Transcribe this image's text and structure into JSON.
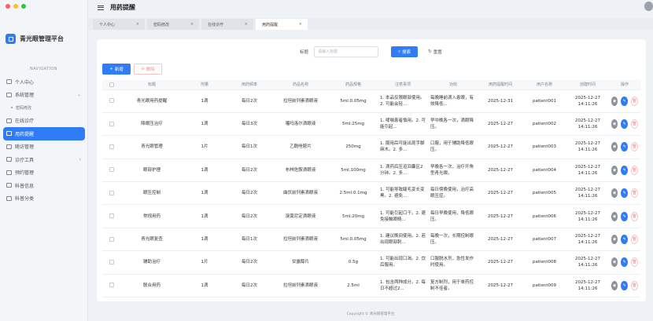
{
  "app": {
    "title": "青光眼管理平台"
  },
  "nav": {
    "section_title": "NAVIGATION",
    "items": [
      {
        "label": "个人中心",
        "icon": "home-icon"
      },
      {
        "label": "系统管理",
        "icon": "folder-icon",
        "expandable": true
      },
      {
        "label": "密码修改",
        "icon": "bullet",
        "sub": true
      },
      {
        "label": "在线诊疗",
        "icon": "folder-icon"
      },
      {
        "label": "用药提醒",
        "icon": "folder-icon",
        "active": true
      },
      {
        "label": "随访管理",
        "icon": "folder-icon"
      },
      {
        "label": "诊疗工具",
        "icon": "folder-icon",
        "expandable": true
      },
      {
        "label": "预约管理",
        "icon": "folder-icon"
      },
      {
        "label": "科普信息",
        "icon": "folder-icon"
      },
      {
        "label": "科普分类",
        "icon": "folder-icon"
      }
    ]
  },
  "header": {
    "title": "用药提醒"
  },
  "tabs": [
    {
      "label": "个人中心",
      "close": "×"
    },
    {
      "label": "密码修改",
      "close": "×"
    },
    {
      "label": "在线诊疗",
      "close": "×"
    },
    {
      "label": "用药提醒",
      "close": "×",
      "active": true
    }
  ],
  "search": {
    "label": "标题",
    "placeholder": "请输入标题",
    "search_button": "搜索",
    "reset_button": "重置"
  },
  "actions": {
    "add": "新增",
    "delete": "删除"
  },
  "table": {
    "columns": [
      "",
      "标题",
      "剂量",
      "用药频率",
      "药品名称",
      "药品规格",
      "注意事项",
      "功效",
      "用药提醒时间",
      "用户名称",
      "创建时间",
      "操作"
    ],
    "rows": [
      [
        "",
        "青光眼用药提醒",
        "1滴",
        "每日2次",
        "拉坦前列素滴眼液",
        "5ml:0.05mg",
        "1. 本品仅限眼部使用。2. 可能会轻...",
        "每晚睡前滴入患眼，有效降低...",
        "2025-12-31",
        "patient001",
        "2025-12-27 14:11:26",
        ""
      ],
      [
        "",
        "降眼压治疗",
        "1滴",
        "每日3次",
        "噻吗洛尔滴眼液",
        "5ml:25mg",
        "1. 哮喘患者慎用。2. 可能引起...",
        "早中晚各一次，滴眼降压。",
        "2025-12-27",
        "patient002",
        "2025-12-27 14:11:26",
        ""
      ],
      [
        "",
        "青光眼管理",
        "1片",
        "每日1次",
        "乙酰唑胺片",
        "250mg",
        "1. 服用后可能出现手脚麻木。2. 多...",
        "口服，用于辅助降低眼压。",
        "2025-12-27",
        "patient003",
        "2025-12-27 14:11:26",
        ""
      ],
      [
        "",
        "眼部护理",
        "1滴",
        "每日2次",
        "布林佐胺滴眼液",
        "5ml:100mg",
        "1. 滴药后压迫泪囊区2分钟。2. 多...",
        "早晚各一次，治疗开角型青光眼。",
        "2025-12-27",
        "patient004",
        "2025-12-27 14:11:26",
        ""
      ],
      [
        "",
        "眼压控制",
        "1滴",
        "每日2次",
        "曲伏前列素滴眼液",
        "2.5ml:0.1mg",
        "1. 可能导致睫毛变长变黑。2. 避免...",
        "每日傍晚使用，治疗高眼压症。",
        "2025-12-27",
        "patient005",
        "2025-12-27 14:11:26",
        ""
      ],
      [
        "",
        "常规用药",
        "1滴",
        "每日2次",
        "溴莫尼定滴眼液",
        "5ml:20mg",
        "1. 可能引起口干。2. 避免接触眼睛...",
        "每日早晚使用，降低眼压。",
        "2025-12-27",
        "patient006",
        "2025-12-27 14:11:26",
        ""
      ],
      [
        "",
        "青光眼复查",
        "1滴",
        "每日1次",
        "拉坦前列素滴眼液",
        "5ml:0.05mg",
        "1. 建议晚间使用。2. 若出现眼部刺...",
        "每晚一次，长期控制眼压。",
        "2025-12-27",
        "patient007",
        "2025-12-27 14:11:26",
        ""
      ],
      [
        "",
        "辅助治疗",
        "1片",
        "每日2次",
        "甘露醇片",
        "0.5g",
        "1. 可能出现口渴。2. 饮后服用。",
        "口服脱水剂，急性发作时使用。",
        "2025-12-27",
        "patient008",
        "2025-12-27 14:11:26",
        ""
      ],
      [
        "",
        "联合用药",
        "1滴",
        "每日2次",
        "拉坦前列素滴眼液",
        "2.5ml",
        "1. 包含两种成分。2. 每日不超过2...",
        "复方制剂，用于单药控制不佳者。",
        "2025-12-27",
        "patient009",
        "2025-12-27 14:11:26",
        ""
      ]
    ]
  },
  "footer": "Copyright © 青光眼管理平台",
  "colors": {
    "accent": "#2f7cf6",
    "danger": "#f08f8f"
  }
}
